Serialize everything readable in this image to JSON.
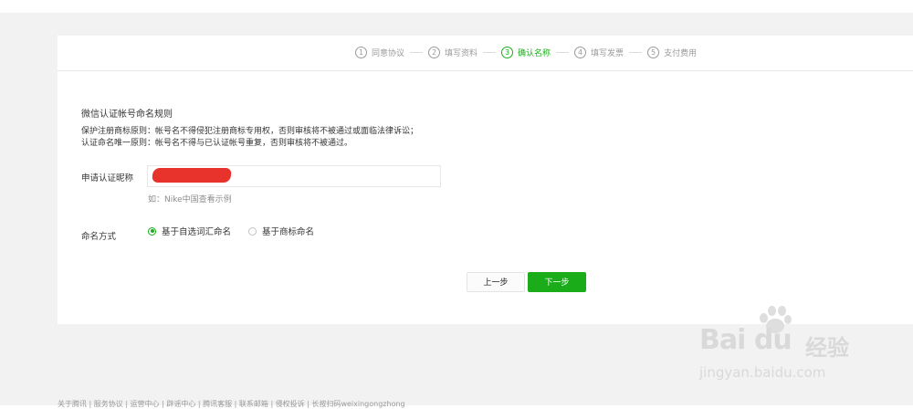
{
  "steps": [
    {
      "num": "1",
      "label": "同意协议",
      "active": false
    },
    {
      "num": "2",
      "label": "填写资料",
      "active": false
    },
    {
      "num": "3",
      "label": "确认名称",
      "active": true
    },
    {
      "num": "4",
      "label": "填写发票",
      "active": false
    },
    {
      "num": "5",
      "label": "支付费用",
      "active": false
    }
  ],
  "rules": {
    "title": "微信认证帐号命名规则",
    "line1": "保护注册商标原则：帐号名不得侵犯注册商标专用权，否则审核将不被通过或面临法律诉讼；",
    "line2": "认证命名唯一原则：帐号名不得与已认证帐号重复，否则审核将不被通过。"
  },
  "form": {
    "name_label": "申请认证昵称",
    "name_value": "",
    "hint": "如：Nike中国查看示例",
    "method_label": "命名方式",
    "options": [
      {
        "label": "基于自选词汇命名",
        "checked": true
      },
      {
        "label": "基于商标命名",
        "checked": false
      }
    ]
  },
  "buttons": {
    "prev": "上一步",
    "next": "下一步"
  },
  "watermark": {
    "brand": "Bai du",
    "cn": "经验",
    "url": "jingyan.baidu.com"
  },
  "footer": "关于腾讯 | 服务协议 | 运营中心 | 辟谣中心 | 腾讯客服 | 联系邮箱 | 侵权投诉 | 长按扫码weixingongzhong",
  "colors": {
    "accent": "#1aad19",
    "redaction": "#e8322c",
    "page_bg": "#f2f2f2"
  }
}
